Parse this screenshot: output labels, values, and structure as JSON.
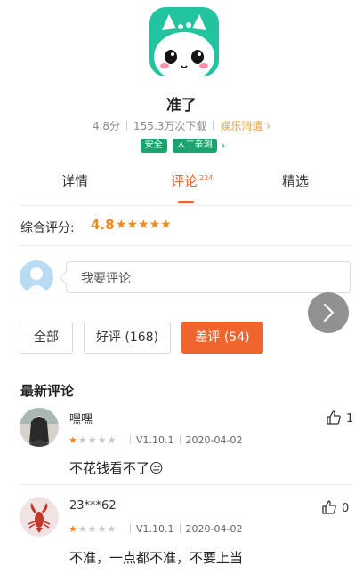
{
  "app": {
    "name": "准了",
    "rating": "4.8分",
    "downloads": "155.3万次下载",
    "category": "娱乐消遣",
    "category_arrow": "›",
    "tags": [
      "安全",
      "人工亲测"
    ],
    "tag_arrow": "›"
  },
  "tabs": [
    {
      "label": "详情"
    },
    {
      "label": "评论",
      "count": "234"
    },
    {
      "label": "精选"
    }
  ],
  "rating": {
    "label": "综合评分:",
    "score": "4.8",
    "stars": "★★★★★"
  },
  "comment_input": {
    "placeholder": "我要评论"
  },
  "filters": [
    {
      "label": "全部"
    },
    {
      "label": "好评 (168)"
    },
    {
      "label": "差评 (54)"
    }
  ],
  "section_title": "最新评论",
  "comments": [
    {
      "user": "嘿嘿",
      "stars_on": "★",
      "stars_off": "★★★★",
      "version": "V1.10.1",
      "date": "2020-04-02",
      "text": "不花钱看不了😒",
      "likes": "1"
    },
    {
      "user": "23***62",
      "stars_on": "★",
      "stars_off": "★★★★",
      "version": "V1.10.1",
      "date": "2020-04-02",
      "text": "不准，一点都不准，不要上当",
      "likes": "0"
    }
  ],
  "colors": {
    "accent": "#f0642e",
    "star": "#f08a1c",
    "tag_green": "#1aa36e",
    "app_icon_bg": "#22c4a0"
  },
  "icons": [
    "app-logo-icon",
    "user-avatar-icon",
    "chevron-right-icon",
    "thumbs-up-icon",
    "lobster-icon"
  ]
}
